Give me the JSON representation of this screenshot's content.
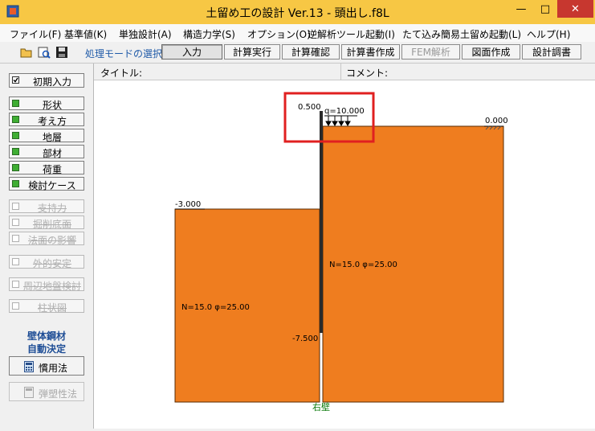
{
  "window": {
    "title": "土留め工の設計 Ver.13 - 頭出し.f8L",
    "min_glyph": "—",
    "max_glyph": "□",
    "close_glyph": "✕"
  },
  "menu": [
    "ファイル(F)",
    "基準値(K)",
    "単独設計(A)",
    "構造力学(S)",
    "オプション(O)",
    "逆解析ツール起動(I)",
    "たて込み簡易土留め起動(L)",
    "ヘルプ(H)"
  ],
  "toolbar": {
    "icons": [
      "open-folder-icon",
      "preview-icon",
      "save-disk-icon"
    ],
    "mode_label": "処理モードの選択",
    "buttons": [
      {
        "label": "入力",
        "active": true
      },
      {
        "label": "計算実行"
      },
      {
        "label": "計算確認"
      },
      {
        "label": "計算書作成"
      },
      {
        "label": "FEM解析",
        "disabled": true
      },
      {
        "label": "図面作成"
      },
      {
        "label": "設計調書"
      }
    ]
  },
  "sidebar": {
    "initial_input": "初期入力",
    "group1": [
      "形状",
      "考え方",
      "地層",
      "部材",
      "荷重",
      "検討ケース"
    ],
    "group2": [
      "支持力",
      "掘削底面",
      "法面の影響"
    ],
    "group3": [
      "外的安定"
    ],
    "group4": [
      "周辺地盤検討"
    ],
    "group5": [
      "柱状図"
    ],
    "auto_label_1": "壁体鋼材",
    "auto_label_2": "自動決定",
    "conventional_button": "慣用法",
    "elastoplastic_button": "弾塑性法"
  },
  "info": {
    "title_label": "タイトル:",
    "comment_label": "コメント:"
  },
  "drawing": {
    "wall_top_elev": "0.500",
    "surcharge_label": "q=10.000",
    "right_ground_elev": "0.000",
    "left_ground_elev": "-3.000",
    "wall_bottom_elev": "-7.500",
    "right_soil": "N=15.0  φ=25.00",
    "left_soil": "N=15.0  φ=25.00",
    "wall_side_label": "右壁",
    "soil_color": "#ef7d1f",
    "highlight_color": "#e02020"
  }
}
